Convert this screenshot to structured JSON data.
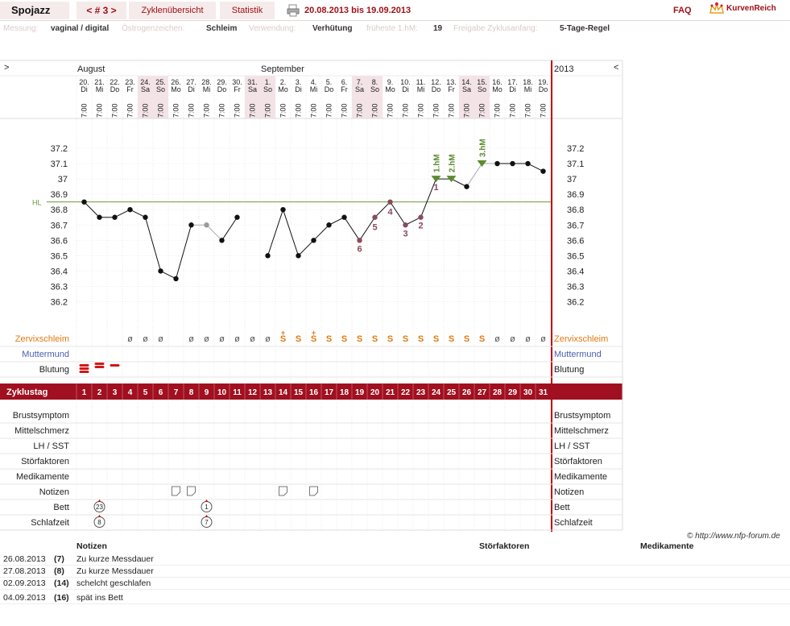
{
  "app": {
    "name": "Spojazz"
  },
  "nav": {
    "cycle_label": "< # 3 >",
    "overview_label": "Zyklenübersicht",
    "stats_label": "Statistik",
    "date_range": "20.08.2013 bis 19.09.2013",
    "faq_label": "FAQ",
    "brand": "KurvenReich"
  },
  "meta": [
    {
      "label": "Messung:",
      "value": "vaginal / digital"
    },
    {
      "label": "Östrogenzeichen:",
      "value": "Schleim"
    },
    {
      "label": "Verwendung:",
      "value": "Verhütung"
    },
    {
      "label": "früheste 1.hM:",
      "value": "19"
    },
    {
      "label": "Freigabe Zyklusanfang:",
      "value": "5-Tage-Regel"
    }
  ],
  "header": {
    "left_arrow": ">",
    "right_arrow": "<",
    "month1": "August",
    "month2": "September",
    "year": "2013"
  },
  "days": [
    {
      "d": "20.",
      "w": "Di",
      "t": "7:00"
    },
    {
      "d": "21.",
      "w": "Mi",
      "t": "7:00"
    },
    {
      "d": "22.",
      "w": "Do",
      "t": "7:00"
    },
    {
      "d": "23.",
      "w": "Fr",
      "t": "7:00"
    },
    {
      "d": "24.",
      "w": "Sa",
      "t": "7:00",
      "we": true
    },
    {
      "d": "25.",
      "w": "So",
      "t": "7:00",
      "we": true
    },
    {
      "d": "26.",
      "w": "Mo",
      "t": "7:00"
    },
    {
      "d": "27.",
      "w": "Di",
      "t": "7:00"
    },
    {
      "d": "28.",
      "w": "Mi",
      "t": "7:00"
    },
    {
      "d": "29.",
      "w": "Do",
      "t": "7:00"
    },
    {
      "d": "30.",
      "w": "Fr",
      "t": "7:00"
    },
    {
      "d": "31.",
      "w": "Sa",
      "t": "7:00",
      "we": true
    },
    {
      "d": "1.",
      "w": "So",
      "t": "7:00",
      "we": true
    },
    {
      "d": "2.",
      "w": "Mo",
      "t": "7:00"
    },
    {
      "d": "3.",
      "w": "Di",
      "t": "7:00"
    },
    {
      "d": "4.",
      "w": "Mi",
      "t": "7:00"
    },
    {
      "d": "5.",
      "w": "Do",
      "t": "7:00"
    },
    {
      "d": "6.",
      "w": "Fr",
      "t": "7:00"
    },
    {
      "d": "7.",
      "w": "Sa",
      "t": "7:00",
      "we": true
    },
    {
      "d": "8.",
      "w": "So",
      "t": "7:00",
      "we": true
    },
    {
      "d": "9.",
      "w": "Mo",
      "t": "7:00"
    },
    {
      "d": "10.",
      "w": "Di",
      "t": "7:00"
    },
    {
      "d": "11.",
      "w": "Mi",
      "t": "7:00"
    },
    {
      "d": "12.",
      "w": "Do",
      "t": "7:00"
    },
    {
      "d": "13.",
      "w": "Fr",
      "t": "7:00"
    },
    {
      "d": "14.",
      "w": "Sa",
      "t": "7:00",
      "we": true
    },
    {
      "d": "15.",
      "w": "So",
      "t": "7:00",
      "we": true
    },
    {
      "d": "16.",
      "w": "Mo",
      "t": "7:00"
    },
    {
      "d": "17.",
      "w": "Di",
      "t": "7:00"
    },
    {
      "d": "18.",
      "w": "Mi",
      "t": "7:00"
    },
    {
      "d": "19.",
      "w": "Do",
      "t": "7:00"
    }
  ],
  "chart_data": {
    "type": "line",
    "x": [
      1,
      2,
      3,
      4,
      5,
      6,
      7,
      8,
      9,
      10,
      11,
      12,
      13,
      14,
      15,
      16,
      17,
      18,
      19,
      20,
      21,
      22,
      23,
      24,
      25,
      26,
      27,
      28,
      29,
      30,
      31
    ],
    "series": [
      {
        "values": [
          null,
          36.85,
          36.75,
          36.75,
          36.8,
          36.75,
          36.4,
          36.35,
          36.7,
          36.7,
          36.6,
          36.75,
          null,
          36.5,
          36.8,
          36.5,
          36.6,
          36.7,
          36.75,
          36.6,
          36.75,
          36.85,
          36.7,
          36.75,
          37.0,
          37.0,
          36.95,
          37.1,
          37.1,
          37.1,
          37.1,
          37.05
        ]
      }
    ],
    "excluded": [
      9,
      27
    ],
    "ylim": [
      36.1,
      37.3
    ],
    "yticks": [
      "37.2",
      "37.1",
      "37",
      "36.9",
      "36.8",
      "36.7",
      "36.6",
      "36.5",
      "36.4",
      "36.3",
      "36.2"
    ],
    "hl_value": 36.85,
    "hl_label": "HL",
    "low_labels": [
      {
        "day": 19,
        "label": "6"
      },
      {
        "day": 20,
        "label": "5"
      },
      {
        "day": 21,
        "label": "4"
      },
      {
        "day": 22,
        "label": "3"
      },
      {
        "day": 23,
        "label": "2"
      },
      {
        "day": 24,
        "label": "1"
      }
    ],
    "hm_labels": [
      {
        "day": 24,
        "label": "1.hM"
      },
      {
        "day": 25,
        "label": "2.hM"
      },
      {
        "day": 27,
        "label": "3.hM"
      }
    ]
  },
  "rows": {
    "zervix": "Zervixschleim",
    "muttermund": "Muttermund",
    "blutung": "Blutung",
    "zyklustag": "Zyklustag",
    "brust": "Brustsymptom",
    "mittel": "Mittelschmerz",
    "lh": "LH / SST",
    "stoer": "Störfaktoren",
    "medi": "Medikamente",
    "notizen": "Notizen",
    "bett": "Bett",
    "schlaf": "Schlafzeit"
  },
  "zervix_values": [
    "",
    "",
    "",
    "ø",
    "ø",
    "ø",
    "",
    "ø",
    "ø",
    "ø",
    "ø",
    "ø",
    "ø",
    "S+",
    "S",
    "S+",
    "S",
    "S",
    "S",
    "S",
    "S",
    "S",
    "S",
    "S",
    "S",
    "S",
    "S",
    "ø",
    "ø",
    "ø",
    "ø"
  ],
  "blood": [
    3,
    2,
    1
  ],
  "note_days": [
    7,
    8,
    14,
    16
  ],
  "bett_badges": [
    {
      "day": 2,
      "text": "23"
    },
    {
      "day": 9,
      "text": "1"
    }
  ],
  "schlaf_badges": [
    {
      "day": 2,
      "text": "8"
    },
    {
      "day": 9,
      "text": "7"
    }
  ],
  "copyright": "© http://www.nfp-forum.de",
  "notes_table": {
    "headers": [
      "Notizen",
      "Störfaktoren",
      "Medikamente"
    ],
    "rows": [
      {
        "date": "26.08.2013",
        "day": "(7)",
        "text": "Zu kurze Messdauer"
      },
      {
        "date": "27.08.2013",
        "day": "(8)",
        "text": "Zu kurze Messdauer"
      },
      {
        "date": "02.09.2013",
        "day": "(14)",
        "text": "schelcht geschlafen"
      },
      {
        "date": "04.09.2013",
        "day": "(16)",
        "text": "spät ins Bett"
      }
    ]
  },
  "colors": {
    "accent": "#a01018",
    "hl_line": "#6b9a3a",
    "temp_dot": "#111",
    "low_num": "#8b4a5a",
    "hm": "#5b8c2e",
    "zervix": "#e07a10",
    "muttermund": "#4a5fb0",
    "weekend": "#f3e3e6"
  }
}
